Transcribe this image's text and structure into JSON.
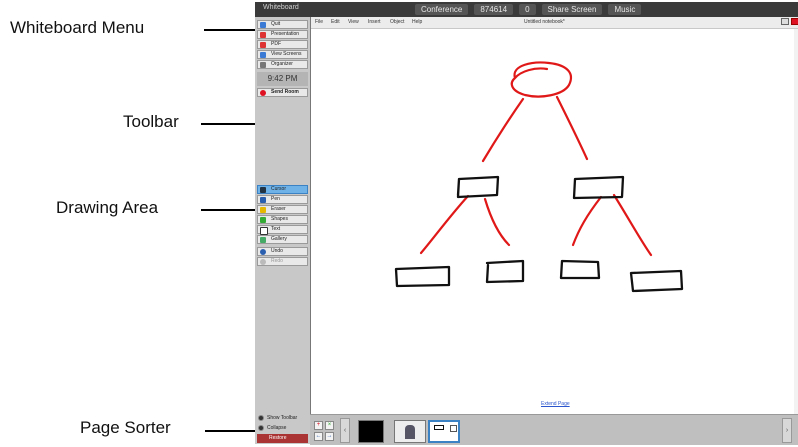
{
  "callouts": {
    "whiteboard_menu": "Whiteboard Menu",
    "toolbar": "Toolbar",
    "drawing_area": "Drawing Area",
    "page_sorter": "Page Sorter"
  },
  "topbar": {
    "title": "Whiteboard",
    "conference": "Conference",
    "code": "874614",
    "count": "0",
    "share_screen": "Share Screen",
    "music": "Music"
  },
  "panel": {
    "buttons": [
      {
        "label": "Quit",
        "icon": "quit-icon",
        "color": "#3b7bd6"
      },
      {
        "label": "Presentation",
        "icon": "presentation-icon",
        "color": "#d33"
      },
      {
        "label": "PDF",
        "icon": "pdf-icon",
        "color": "#d33"
      },
      {
        "label": "View Screens",
        "icon": "screens-icon",
        "color": "#3b7bd6"
      },
      {
        "label": "Organizer",
        "icon": "organizer-icon",
        "color": "#777"
      }
    ],
    "time": "9:42 PM",
    "send_room": "Send Room",
    "tools": [
      {
        "label": "Cursor",
        "icon": "cursor-icon"
      },
      {
        "label": "Pen",
        "icon": "pen-icon"
      },
      {
        "label": "Eraser",
        "icon": "eraser-icon"
      },
      {
        "label": "Shapes",
        "icon": "shapes-icon"
      },
      {
        "label": "Text",
        "icon": "text-icon"
      },
      {
        "label": "Gallery",
        "icon": "gallery-icon"
      },
      {
        "label": "Undo",
        "icon": "undo-icon"
      },
      {
        "label": "Redo",
        "icon": "redo-icon"
      }
    ],
    "show_toolbar": "Show Toolbar",
    "collapse": "Collapse",
    "restore": "Restore"
  },
  "menubar": {
    "items": [
      "File",
      "Edit",
      "View",
      "Insert",
      "Object",
      "Help"
    ],
    "notebook": "Untitled notebook*"
  },
  "whiteboard": {
    "extend_page": "Extend Page",
    "ink_color": "#e01818",
    "box_color": "#111111"
  },
  "colors": {
    "panel_bg": "#c8c8c8",
    "active_tool": "#6fb2e8",
    "topbar_bg": "#3a3a3a"
  }
}
